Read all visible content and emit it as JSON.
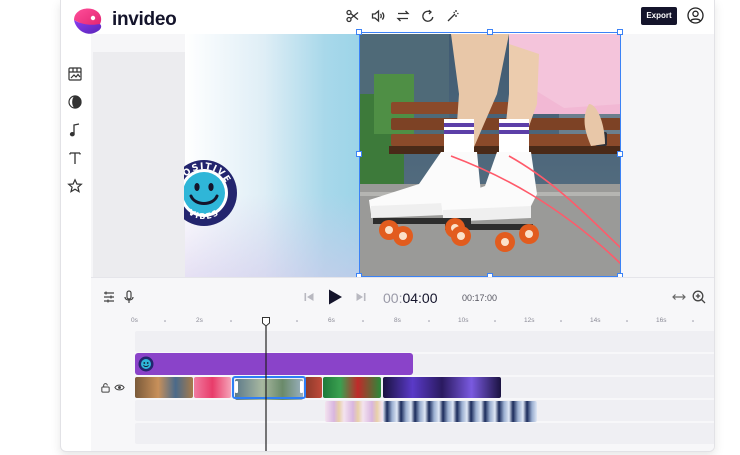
{
  "app": {
    "brand": "invideo",
    "colors": {
      "accent": "#3b82f6",
      "brand_pink": "#e93a7d",
      "brand_purple": "#6d2fc7",
      "text_clip": "#8a43c9",
      "dark": "#14142b"
    }
  },
  "header": {
    "tools": [
      {
        "name": "scissors-icon"
      },
      {
        "name": "volume-icon"
      },
      {
        "name": "swap-icon"
      },
      {
        "name": "rotate-icon"
      },
      {
        "name": "magic-wand-icon"
      }
    ],
    "export_label": "Export",
    "account_icon": "user-circle-icon"
  },
  "rail": {
    "items": [
      {
        "name": "media-library-icon"
      },
      {
        "name": "palette-icon"
      },
      {
        "name": "music-note-icon"
      },
      {
        "name": "text-icon"
      },
      {
        "name": "star-icon"
      }
    ]
  },
  "canvas": {
    "sticker_text": "POSITIVE VIBES"
  },
  "timeline": {
    "current_time_dim": "00:",
    "current_time": "04:00",
    "total_time": "00:17:00",
    "ruler_labels": [
      "0s",
      "2s",
      "4s",
      "6s",
      "8s",
      "10s",
      "12s",
      "14s",
      "16s"
    ],
    "icons": [
      "list-icon",
      "microphone-icon",
      "skip-back-icon",
      "play-icon",
      "skip-forward-icon",
      "fit-width-icon",
      "zoom-in-icon"
    ],
    "track_icons": [
      "lock-icon",
      "eye-icon"
    ]
  }
}
